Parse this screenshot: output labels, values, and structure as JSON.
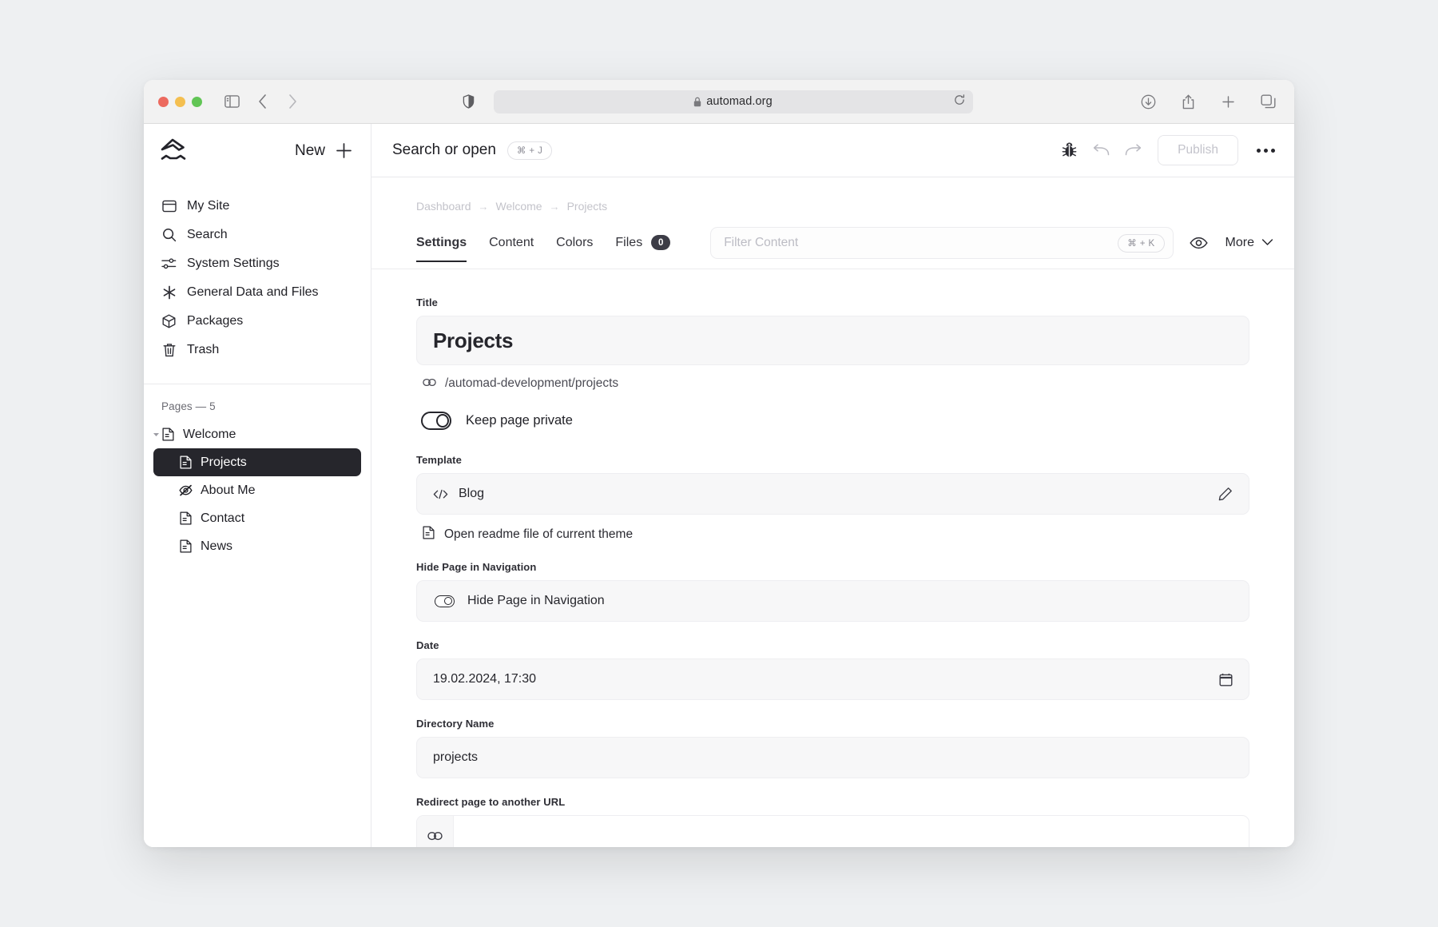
{
  "browser": {
    "url": "automad.org",
    "lock_icon": "lock-icon",
    "sidebar_toggle_icon": "sidebar-toggle-icon",
    "back_icon": "back-chevron-icon",
    "forward_icon": "forward-chevron-icon",
    "shield_icon": "privacy-shield-icon",
    "reload_icon": "reload-icon",
    "download_icon": "download-icon",
    "share_icon": "share-icon",
    "newtab_icon": "plus-icon",
    "tabs_icon": "tab-overview-icon"
  },
  "sidebar": {
    "logo_name": "automad-logo",
    "new_label": "New",
    "nav": [
      {
        "label": "My Site",
        "icon": "browser-window-icon"
      },
      {
        "label": "Search",
        "icon": "search-icon"
      },
      {
        "label": "System Settings",
        "icon": "sliders-icon"
      },
      {
        "label": "General Data and Files",
        "icon": "asterisk-icon"
      },
      {
        "label": "Packages",
        "icon": "package-icon"
      },
      {
        "label": "Trash",
        "icon": "trash-icon"
      }
    ],
    "pages_header": "Pages — 5",
    "tree": [
      {
        "label": "Welcome",
        "icon": "file-text-icon",
        "level": 0,
        "active": false,
        "caret": true
      },
      {
        "label": "Projects",
        "icon": "file-text-icon",
        "level": 1,
        "active": true,
        "caret": false
      },
      {
        "label": "About Me",
        "icon": "eye-off-icon",
        "level": 1,
        "active": false,
        "caret": false
      },
      {
        "label": "Contact",
        "icon": "file-text-icon",
        "level": 1,
        "active": false,
        "caret": false
      },
      {
        "label": "News",
        "icon": "file-text-icon",
        "level": 1,
        "active": false,
        "caret": false
      }
    ]
  },
  "header": {
    "search_label": "Search or open",
    "search_shortcut": "⌘ + J",
    "bug_icon": "bug-icon",
    "undo_icon": "undo-icon",
    "redo_icon": "redo-icon",
    "publish_label": "Publish",
    "overflow_icon": "more-dots-icon"
  },
  "breadcrumb": {
    "items": [
      "Dashboard",
      "Welcome",
      "Projects"
    ],
    "separator": "→"
  },
  "tabs": {
    "items": [
      {
        "label": "Settings",
        "active": true,
        "badge": null
      },
      {
        "label": "Content",
        "active": false,
        "badge": null
      },
      {
        "label": "Colors",
        "active": false,
        "badge": null
      },
      {
        "label": "Files",
        "active": false,
        "badge": "0"
      }
    ],
    "filter_placeholder": "Filter Content",
    "filter_shortcut": "⌘ + K",
    "preview_icon": "eye-icon",
    "more_label": "More",
    "more_icon": "chevron-down-icon"
  },
  "form": {
    "title": {
      "label": "Title",
      "value": "Projects",
      "slug": "/automad-development/projects",
      "slug_icon": "link-icon"
    },
    "private": {
      "label": "Keep page private",
      "enabled": false,
      "icon": "toggle-icon"
    },
    "template": {
      "label": "Template",
      "value": "Blog",
      "value_icon": "code-icon",
      "edit_icon": "pencil-icon",
      "readme_label": "Open readme file of current theme",
      "readme_icon": "file-text-icon"
    },
    "hide_nav": {
      "label": "Hide Page in Navigation",
      "toggle_label": "Hide Page in Navigation",
      "enabled": false
    },
    "date": {
      "label": "Date",
      "value": "19.02.2024, 17:30",
      "picker_icon": "calendar-icon"
    },
    "directory": {
      "label": "Directory Name",
      "value": "projects"
    },
    "redirect": {
      "label": "Redirect page to another URL",
      "value": "",
      "icon": "link-icon"
    }
  }
}
